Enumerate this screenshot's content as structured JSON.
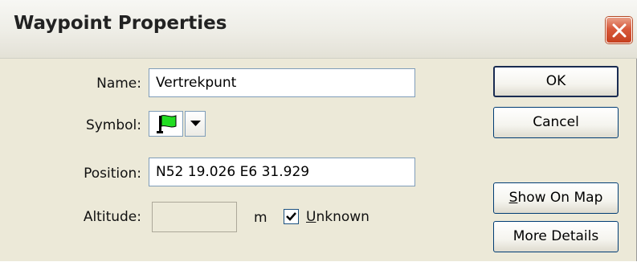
{
  "window": {
    "title": "Waypoint Properties",
    "close_icon": "close-icon"
  },
  "fields": {
    "name": {
      "label": "Name:",
      "value": "Vertrekpunt"
    },
    "symbol": {
      "label": "Symbol:",
      "icon": "green-flag-icon"
    },
    "position": {
      "label": "Position:",
      "value": "N52 19.026 E6 31.929"
    },
    "altitude": {
      "label": "Altitude:",
      "value": "",
      "unit": "m"
    },
    "unknown": {
      "label_first": "U",
      "label_rest": "nknown",
      "checked": true
    }
  },
  "buttons": {
    "ok": "OK",
    "cancel": "Cancel",
    "show_on_map_first": "S",
    "show_on_map_rest": "how On Map",
    "more_details": "More Details"
  },
  "colors": {
    "close_button": "#d8593b",
    "flag_green": "#22dd22"
  }
}
